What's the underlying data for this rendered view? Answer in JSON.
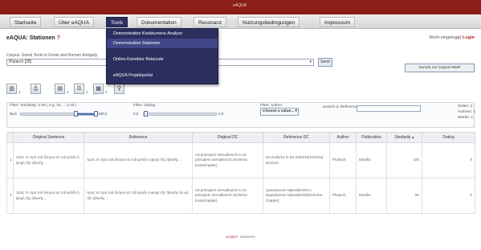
{
  "topbar": {
    "brand": "eAQUA"
  },
  "menu": [
    {
      "label": "Startseite"
    },
    {
      "label": "Über eAQUA"
    },
    {
      "label": "Tools"
    },
    {
      "label": "Dokumentation"
    },
    {
      "label": "Resonanz"
    },
    {
      "label": "Nutzungsbedingungen"
    },
    {
      "label": "Impressum"
    }
  ],
  "dropdown": [
    "Demonstration Kookkurrenz-Analyse",
    "Demonstration Stationen",
    "Online-Korrektur Betacode",
    "eAQUA Projektportal"
  ],
  "page": {
    "brand": "eAQUA",
    "title_suffix": ": Stationen",
    "star": "?"
  },
  "login": {
    "status": "Nicht eingeloggt",
    "link": "Login"
  },
  "corpus": {
    "label": "Corpus: Greek Texts in Greek and Roman Antiquity",
    "selected": "Plutarch [28]",
    "send_label": "Send",
    "switch_label": "Zurück zur Corpus-Wahl"
  },
  "toolbar": {
    "counts": [
      "1",
      "1",
      "1",
      "1"
    ]
  },
  "filters": {
    "similarity_label": "Filter: Similarity: ≥ 66 ( e.g. 33 → 0.33 )",
    "similarity_min": "66,6",
    "similarity_max": "100,0",
    "dating_label": "Filter: Dating",
    "dating_min": "0,0",
    "dating_max": "0,0",
    "author_label": "Filter: Author",
    "author_select": "Choose a value... ▾",
    "search_label": "Search in Reference:",
    "summary_lines": [
      "Zeilen: 2",
      "Autoren: 1",
      "Werke: 1"
    ]
  },
  "table": {
    "headers": [
      "",
      "Original Sentence",
      "Reference",
      "Original DC",
      "Reference DC",
      "Author",
      "Publication",
      "Similarity ▴",
      "Dating"
    ],
    "rows": [
      {
        "idx": "1",
        "original": "πρὸς τὸ πρὸ τοῦ ἄλογον ἐκ τοῦ φιλεῖν ἡ ψυχὴ τῆς ἡδονῆς ...",
        "reference": "πρὸς τὸ πρὸ τοῦ ἄλογον ἐκ τοῦ φιλεῖν ἡ ψυχὴ τῆς ἡδονῆς ...",
        "original_dc": "Ad principem ineruditum/3 in Ad principem ineruditum/3 (Schema book/chapter)",
        "reference_dc": "De exilio/15 In De exilio/15(Schema section)",
        "author": "Plutarch",
        "publication": "Moralia",
        "similarity": "100",
        "dating": "0"
      },
      {
        "idx": "2",
        "original": "πρὸς τὸ πρὸ τοῦ ἄλογον ἐκ τοῦ φιλεῖν ἡ ψυχὴ τῆς ἡδονῆς ...",
        "reference": "πρὸς τὸ πρὸ τοῦ ἄλογον ἐκ τοῦ φιλεῖν ἡ ψυχὴ τῆς ἡδονῆς ὅτι μὴ τῆς ἡδονῆς ...",
        "original_dc": "Ad principem ineruditum/3 in Ad principem ineruditum/3 (Schema book/chapter)",
        "reference_dc": "Quaestiones Naturales/29 in Quaestiones Naturales/29(Schema chapter)",
        "author": "Plutarch",
        "publication": "Moralia",
        "similarity": "90",
        "dating": "0"
      }
    ]
  },
  "footer": {
    "brand": "eAQUA",
    "text": ": Stationen"
  }
}
